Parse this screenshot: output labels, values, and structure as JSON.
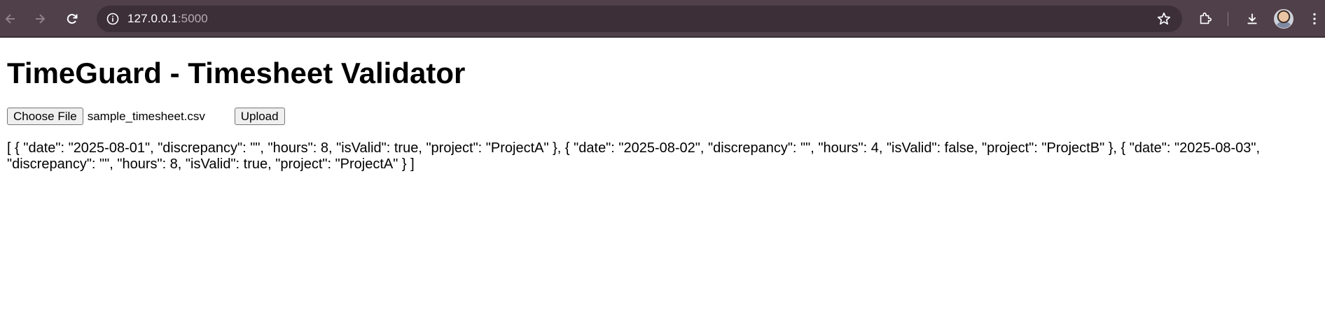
{
  "browser": {
    "url_host": "127.0.0.1",
    "url_port": ":5000",
    "icons": [
      "back-icon",
      "forward-icon",
      "reload-icon",
      "site-info-icon",
      "star-icon",
      "extensions-icon",
      "download-icon",
      "avatar",
      "menu-icon"
    ]
  },
  "page": {
    "title": "TimeGuard - Timesheet Validator",
    "choose_file_label": "Choose File",
    "file_name": "sample_timesheet.csv",
    "upload_label": "Upload",
    "result_text": "[ { \"date\": \"2025-08-01\", \"discrepancy\": \"\", \"hours\": 8, \"isValid\": true, \"project\": \"ProjectA\" }, { \"date\": \"2025-08-02\", \"discrepancy\": \"\", \"hours\": 4, \"isValid\": false, \"project\": \"ProjectB\" }, { \"date\": \"2025-08-03\", \"discrepancy\": \"\", \"hours\": 8, \"isValid\": true, \"project\": \"ProjectA\" } ]"
  },
  "colors": {
    "toolbar_bg": "#4f4049",
    "omnibox_bg": "#3c2f38",
    "page_bg": "#ffffff"
  }
}
